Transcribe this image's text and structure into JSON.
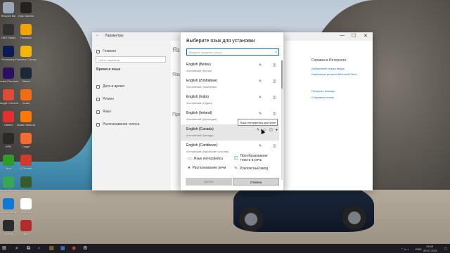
{
  "desktop": {
    "icons": [
      {
        "label": "Recycle Bin",
        "color": "#9aa8b6"
      },
      {
        "label": "Epic Games",
        "color": "#222222"
      },
      {
        "label": "OBS Studio",
        "color": "#303030"
      },
      {
        "label": "Rockstar",
        "color": "#f4a300"
      },
      {
        "label": "Photoshop",
        "color": "#0a1b4f"
      },
      {
        "label": "Rockstar Games",
        "color": "#f7b500"
      },
      {
        "label": "Adobe Premiere",
        "color": "#2b1060"
      },
      {
        "label": "Steam",
        "color": "#1b2838"
      },
      {
        "label": "Google Chrome",
        "color": "#dd4b39"
      },
      {
        "label": "Avast",
        "color": "#f36b15"
      },
      {
        "label": "Yandex",
        "color": "#e62e2e"
      },
      {
        "label": "Avast Cleanup",
        "color": "#ff7800"
      },
      {
        "label": "VPN",
        "color": "#2a2a2a"
      },
      {
        "label": "Origin",
        "color": "#f56c2d"
      },
      {
        "label": "Xbox",
        "color": "#2d9c2d"
      },
      {
        "label": "CCleaner",
        "color": "#d33a2c"
      },
      {
        "label": "Google Chrome",
        "color": "#34a853"
      },
      {
        "label": "Games",
        "color": "#3a5a2a"
      },
      {
        "label": "Microsoft Edge",
        "color": "#0f78d4"
      },
      {
        "label": "Document",
        "color": "#ffffff"
      },
      {
        "label": "NVIDIA",
        "color": "#2b2b2b"
      },
      {
        "label": "App",
        "color": "#b52a2a"
      }
    ]
  },
  "settings": {
    "window_title": "Параметры",
    "controls": {
      "minimize": "—",
      "maximize": "☐",
      "close": "✕"
    },
    "sidebar": {
      "home": "Главная",
      "search_placeholder": "Найти параметр",
      "section_title": "Время и язык",
      "items": [
        "Дата и время",
        "Регион",
        "Язык",
        "Распознавание голоса"
      ]
    },
    "main_heading_fragments": [
      "Язык",
      "Язык",
      "Пре"
    ],
    "right_panel": {
      "heading": "Справка в Интернете",
      "links": [
        "Добавление языка ввода",
        "Изменение региона Microsoft Store"
      ],
      "help": "Получить помощь",
      "feedback": "Отправить отзыв"
    }
  },
  "dialog": {
    "title": "Выберите язык для установки",
    "search_placeholder": "Введите название языка...",
    "languages": [
      {
        "name": "English (Belize)",
        "sub": "Английский (Белиз)",
        "selected": false
      },
      {
        "name": "English (Zimbabwe)",
        "sub": "Английский (Зимбабве)",
        "selected": false
      },
      {
        "name": "English (India)",
        "sub": "Английский (Индия)",
        "selected": false
      },
      {
        "name": "English (Ireland)",
        "sub": "Английский (Ирландия)",
        "selected": false
      },
      {
        "name": "English (Canada)",
        "sub": "Английский (Канада)",
        "selected": true
      },
      {
        "name": "English (Caribbean)",
        "sub": "Английский (Карибские острова)",
        "selected": false
      }
    ],
    "tooltip": "Язык интерфейса доступен",
    "legend": [
      {
        "label": "Язык интерфейса",
        "icon": "display-language-icon"
      },
      {
        "label": "Преобразование текста в речь",
        "icon": "text-to-speech-icon"
      },
      {
        "label": "Распознавание речи",
        "icon": "speech-recognition-icon"
      },
      {
        "label": "Рукописный ввод",
        "icon": "handwriting-icon"
      }
    ],
    "buttons": {
      "install": "Далее",
      "cancel": "Отмена"
    }
  },
  "taskbar": {
    "language": "ENG",
    "time": "19:40",
    "date": "20.07.2021"
  }
}
